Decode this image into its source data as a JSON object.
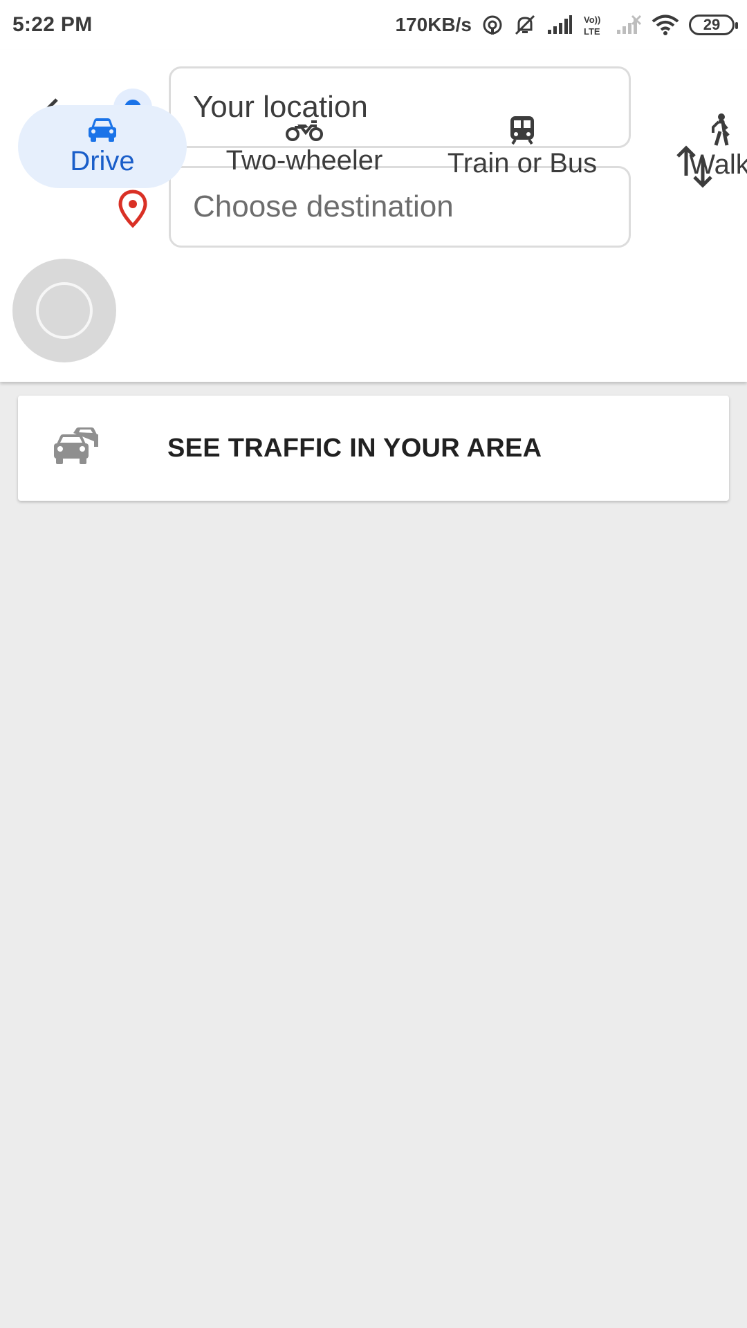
{
  "status_bar": {
    "time": "5:22 PM",
    "network_speed": "170KB/s",
    "volte": "Vo LTE",
    "battery": "29",
    "icons": [
      "hotspot-icon",
      "mute-icon",
      "signal-icon",
      "volte-icon",
      "signal-weak-icon",
      "wifi-icon",
      "battery-icon"
    ]
  },
  "header": {
    "origin_value": "Your location",
    "destination_placeholder": "Choose destination",
    "icons": [
      "back-arrow-icon",
      "origin-dot-icon",
      "destination-pin-icon",
      "swap-icon"
    ]
  },
  "modes": {
    "selected": "Drive",
    "items": [
      {
        "label": "Drive",
        "icon": "car-icon"
      },
      {
        "label": "Two-wheeler",
        "icon": "motorcycle-icon"
      },
      {
        "label": "Train or Bus",
        "icon": "transit-icon"
      },
      {
        "label": "Walk",
        "icon": "walk-icon"
      }
    ]
  },
  "traffic_card": {
    "label": "SEE TRAFFIC IN YOUR AREA",
    "icon": "traffic-cars-icon"
  },
  "colors": {
    "accent": "#1a73e8",
    "selected_mode_bg": "#e6effc",
    "pin_red": "#d93025",
    "page_bg": "#ececec"
  }
}
